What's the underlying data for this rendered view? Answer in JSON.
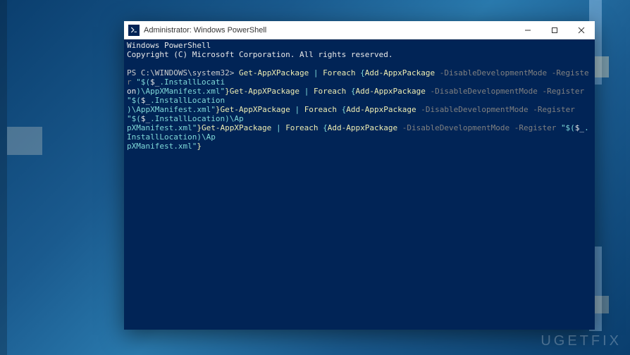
{
  "window": {
    "title": "Administrator: Windows PowerShell"
  },
  "terminal": {
    "header_line1": "Windows PowerShell",
    "header_line2": "Copyright (C) Microsoft Corporation. All rights reserved.",
    "prompt": "PS C:\\WINDOWS\\system32> ",
    "cmd_1_yellow_a": "Get-AppXPackage ",
    "cmd_1_cyan_a": "| ",
    "cmd_1_yellow_b": "Foreach ",
    "cmd_1_cyan_b": "{",
    "cmd_1_yellow_c": "Add-AppxPackage ",
    "cmd_1_gray_a": "-DisableDevelopmentMode -Register ",
    "cmd_1_cyan_c": "\"$(",
    "cmd_1_white_a": "$_",
    "cmd_1_cyan_d": ".InstallLocati",
    "cmd_2_white_a": "on",
    "cmd_2_cyan_a": ")\\AppXManifest.xml\"",
    "cmd_2_yellow_a": "}Get-AppXPackage ",
    "cmd_2_cyan_b": "| ",
    "cmd_2_yellow_b": "Foreach ",
    "cmd_2_cyan_c": "{",
    "cmd_2_yellow_c": "Add-AppxPackage ",
    "cmd_2_gray_a": "-DisableDevelopmentMode -Register ",
    "cmd_2_cyan_d": "\"$(",
    "cmd_2_white_b": "$_",
    "cmd_2_cyan_e": ".InstallLocation",
    "cmd_3_cyan_a": ")\\AppXManifest.xml\"",
    "cmd_3_yellow_a": "}Get-AppXPackage ",
    "cmd_3_cyan_b": "| ",
    "cmd_3_yellow_b": "Foreach ",
    "cmd_3_cyan_c": "{",
    "cmd_3_yellow_c": "Add-AppxPackage ",
    "cmd_3_gray_a": "-DisableDevelopmentMode -Register ",
    "cmd_3_cyan_d": "\"$(",
    "cmd_3_white_a": "$_",
    "cmd_3_cyan_e": ".InstallLocation)\\Ap",
    "cmd_4_cyan_a": "pXManifest.xml\"",
    "cmd_4_yellow_a": "}Get-AppXPackage ",
    "cmd_4_cyan_b": "| ",
    "cmd_4_yellow_b": "Foreach ",
    "cmd_4_cyan_c": "{",
    "cmd_4_yellow_c": "Add-AppxPackage ",
    "cmd_4_gray_a": "-DisableDevelopmentMode -Register ",
    "cmd_4_cyan_d": "\"$(",
    "cmd_4_white_a": "$_",
    "cmd_4_cyan_e": ".InstallLocation)\\Ap",
    "cmd_5_cyan_a": "pXManifest.xml\"",
    "cmd_5_yellow_a": "}"
  },
  "watermark": "UGETFIX"
}
